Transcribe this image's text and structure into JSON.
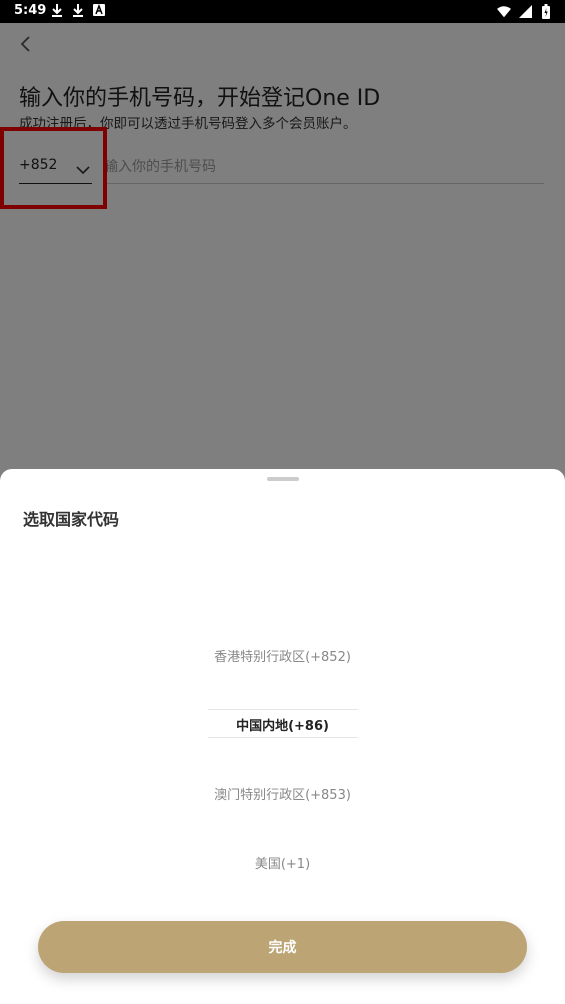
{
  "status_bar": {
    "time": "5:49"
  },
  "page": {
    "title": "输入你的手机号码，开始登记One ID",
    "subtitle": "成功注册后，你即可以透过手机号码登入多个会员账户。",
    "country_code": "+852",
    "phone_placeholder": "输入你的手机号码"
  },
  "sheet": {
    "title": "选取国家代码",
    "options": [
      {
        "label": "香港特别行政区(+852)"
      },
      {
        "label": "中国内地(+86)"
      },
      {
        "label": "澳门特别行政区(+853)"
      },
      {
        "label": "美国(+1)"
      }
    ],
    "selected_index": 1,
    "done_label": "完成"
  },
  "colors": {
    "accent": "#bca474",
    "highlight": "#ff0000"
  },
  "icons": [
    "download-icon",
    "download-icon",
    "a-icon",
    "wifi-icon",
    "signal-icon",
    "battery-icon",
    "back-icon",
    "chevron-down-icon"
  ]
}
